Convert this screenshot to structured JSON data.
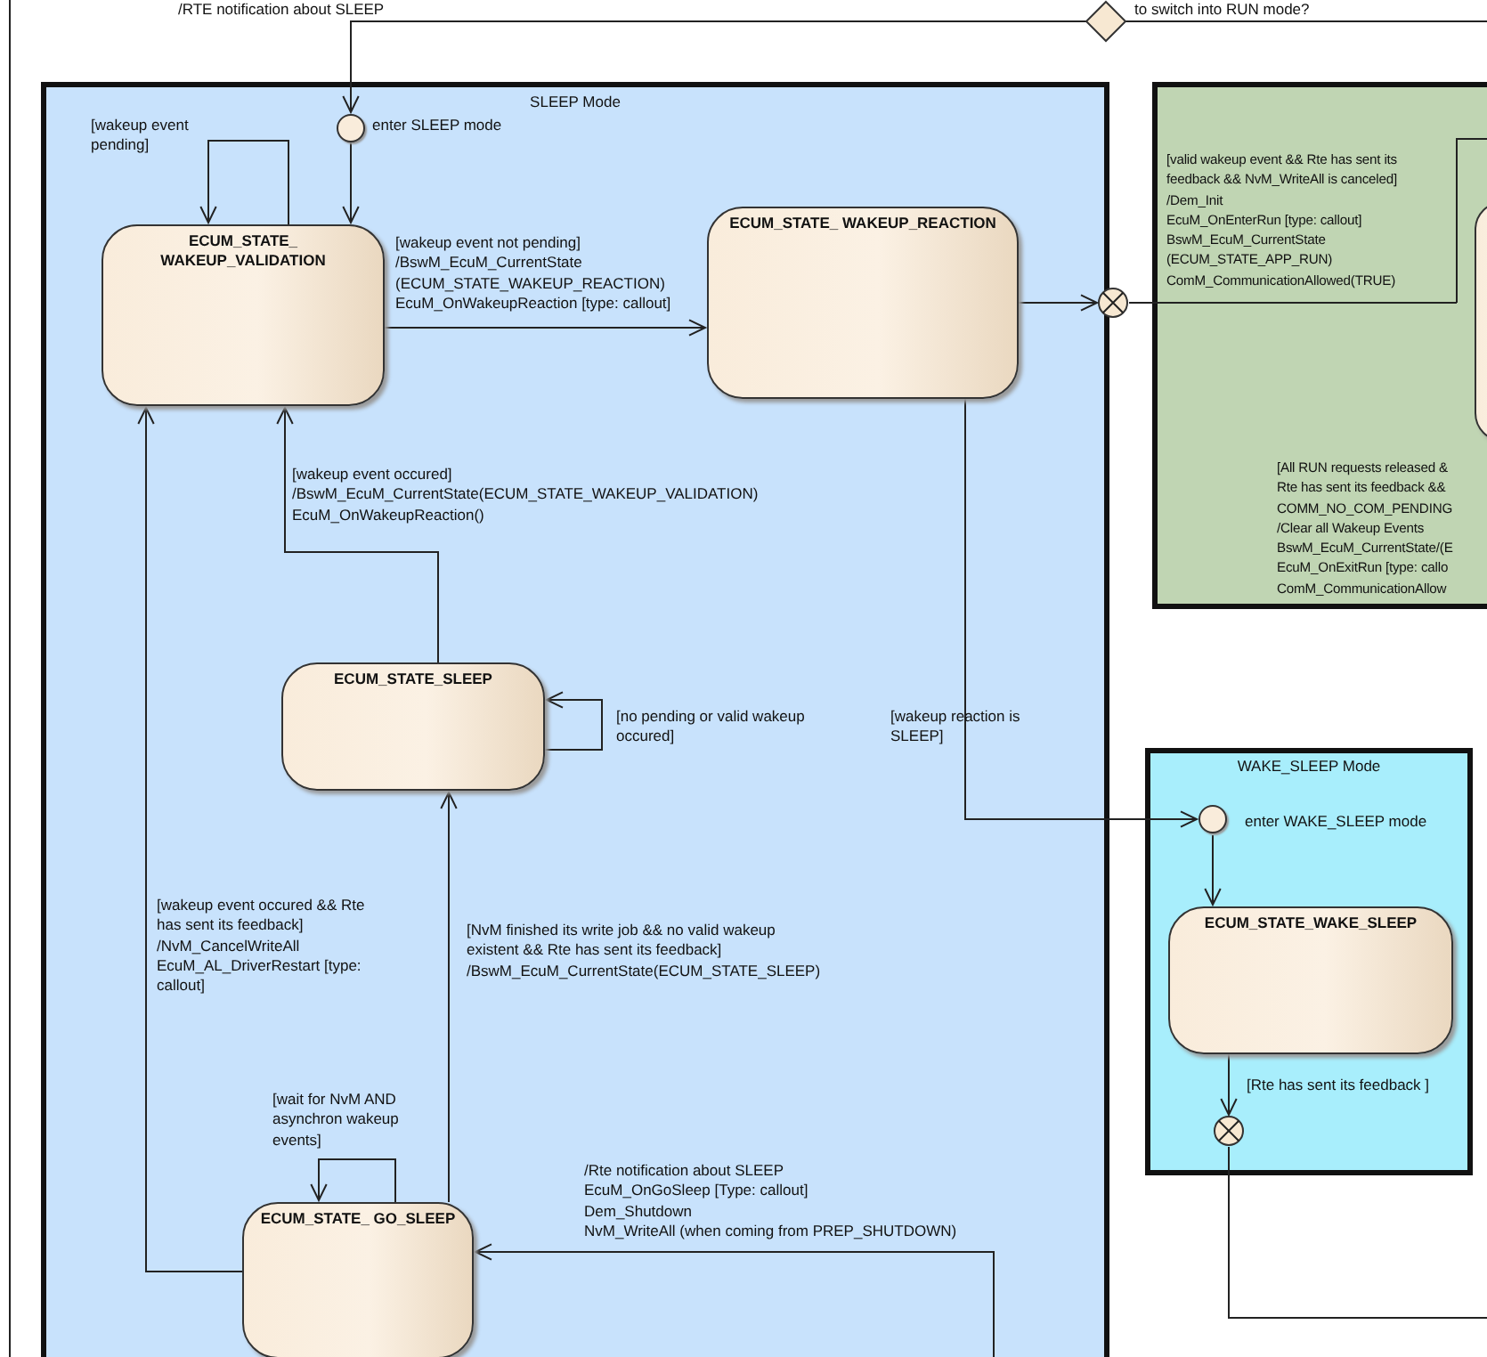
{
  "top_labels": [
    {
      "text": "/RTE notification about SLEEP"
    },
    {
      "text": "to switch into RUN mode?"
    }
  ],
  "regions": [
    {
      "kind": "sleep",
      "title": "SLEEP Mode"
    },
    {
      "kind": "run"
    },
    {
      "kind": "wake_sleep",
      "title": "WAKE_SLEEP Mode"
    }
  ],
  "entry_points": [
    {
      "label": "enter SLEEP mode"
    },
    {
      "label": "enter WAKE_SLEEP mode"
    }
  ],
  "states": [
    {
      "title": "ECUM_STATE_\nWAKEUP_VALIDATION"
    },
    {
      "title": "ECUM_STATE_ WAKEUP_REACTION"
    },
    {
      "title": "ECUM_STATE_SLEEP"
    },
    {
      "title": "ECUM_STATE_ GO_SLEEP"
    },
    {
      "title": "ECUM_STATE_WAKE_SLEEP"
    }
  ],
  "transitions": [
    {
      "label": "[wakeup event\npending]"
    },
    {
      "label": "[wakeup event not pending]\n/BswM_EcuM_CurrentState\n(ECUM_STATE_WAKEUP_REACTION)\nEcuM_OnWakeupReaction [type: callout]"
    },
    {
      "label": "[valid wakeup event && Rte has sent its\nfeedback && NvM_WriteAll is canceled]\n/Dem_Init\nEcuM_OnEnterRun [type: callout]\nBswM_EcuM_CurrentState\n(ECUM_STATE_APP_RUN)\nComM_CommunicationAllowed(TRUE)"
    },
    {
      "label": "[wakeup event occured]\n/BswM_EcuM_CurrentState(ECUM_STATE_WAKEUP_VALIDATION)\nEcuM_OnWakeupReaction()"
    },
    {
      "label": "[All RUN requests released &\nRte has sent its feedback &&\nCOMM_NO_COM_PENDING\n/Clear all Wakeup Events\nBswM_EcuM_CurrentState/(E\nEcuM_OnExitRun [type: callo\nComM_CommunicationAllow"
    },
    {
      "label": "[no pending or valid wakeup\noccured]"
    },
    {
      "label": "[wakeup reaction is\nSLEEP]"
    },
    {
      "label": "[wakeup event occured && Rte\nhas sent its feedback]\n/NvM_CancelWriteAll\nEcuM_AL_DriverRestart [type:\ncallout]"
    },
    {
      "label": "[NvM finished its write job && no valid wakeup\nexistent && Rte has sent its feedback]\n/BswM_EcuM_CurrentState(ECUM_STATE_SLEEP)"
    },
    {
      "label": "[wait for NvM AND\nasynchron wakeup\nevents]"
    },
    {
      "label": "/Rte notification about SLEEP\nEcuM_OnGoSleep [Type: callout]\nDem_Shutdown\nNvM_WriteAll (when coming from PREP_SHUTDOWN)"
    },
    {
      "label": "[Rte has sent its feedback ]"
    }
  ]
}
